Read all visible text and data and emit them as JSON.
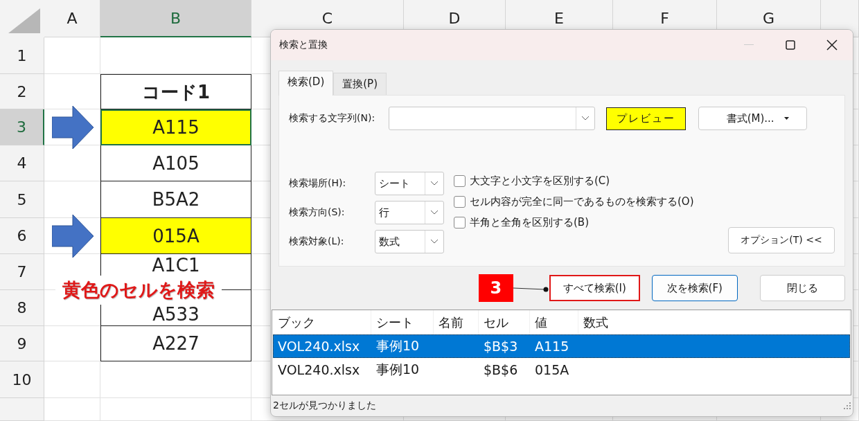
{
  "sheet": {
    "columns": [
      {
        "label": "A",
        "selected": false
      },
      {
        "label": "B",
        "selected": true
      },
      {
        "label": "C",
        "selected": false
      },
      {
        "label": "D",
        "selected": false
      },
      {
        "label": "E",
        "selected": false
      },
      {
        "label": "F",
        "selected": false
      },
      {
        "label": "G",
        "selected": false
      }
    ],
    "rows": [
      {
        "number": "1",
        "selected": false
      },
      {
        "number": "2",
        "selected": false,
        "value": "コード1",
        "kind": "header"
      },
      {
        "number": "3",
        "selected": true,
        "value": "A115",
        "kind": "data",
        "highlighted": true,
        "arrow": true
      },
      {
        "number": "4",
        "selected": false,
        "value": "A105",
        "kind": "data",
        "highlighted": false,
        "arrow": false
      },
      {
        "number": "5",
        "selected": false,
        "value": "B5A2",
        "kind": "data",
        "highlighted": false,
        "arrow": false
      },
      {
        "number": "6",
        "selected": false,
        "value": "015A",
        "kind": "data",
        "highlighted": true,
        "arrow": true
      },
      {
        "number": "7",
        "selected": false,
        "value": "A1C1",
        "kind": "data",
        "highlighted": false,
        "arrow": false
      },
      {
        "number": "8",
        "selected": false,
        "value": "A533",
        "kind": "data",
        "highlighted": false,
        "arrow": false
      },
      {
        "number": "9",
        "selected": false,
        "value": "A227",
        "kind": "data",
        "highlighted": false,
        "arrow": false
      },
      {
        "number": "10",
        "selected": false
      }
    ],
    "callout": "黄色のセルを検索"
  },
  "dialog": {
    "title": "検索と置換",
    "tabs": [
      {
        "label": "検索(D)",
        "selected": true
      },
      {
        "label": "置換(P)",
        "selected": false
      }
    ],
    "find_what": {
      "label": "検索する文字列(N):"
    },
    "preview": "プレビュー",
    "format_button": "書式(M)...",
    "dropdowns": [
      {
        "label": "検索場所(H):",
        "value": "シート"
      },
      {
        "label": "検索方向(S):",
        "value": "行"
      },
      {
        "label": "検索対象(L):",
        "value": "数式"
      }
    ],
    "checkboxes": [
      {
        "label": "大文字と小文字を区別する(C)",
        "checked": false
      },
      {
        "label": "セル内容が完全に同一であるものを検索する(O)",
        "checked": false
      },
      {
        "label": "半角と全角を区別する(B)",
        "checked": false
      }
    ],
    "options_button": "オプション(T) <<",
    "step_badge": "3",
    "buttons": [
      {
        "label": "すべて検索(I)",
        "kind": "find_all",
        "highlighted": true,
        "focused": false
      },
      {
        "label": "次を検索(F)",
        "kind": "find_next",
        "highlighted": false,
        "focused": true
      },
      {
        "label": "閉じる",
        "kind": "close",
        "highlighted": false,
        "focused": false
      }
    ],
    "results": {
      "columns": [
        "ブック",
        "シート",
        "名前",
        "セル",
        "値",
        "数式"
      ],
      "rows": [
        {
          "cells": [
            "VOL240.xlsx",
            "事例10",
            "",
            "$B$3",
            "A115",
            ""
          ],
          "selected": true
        },
        {
          "cells": [
            "VOL240.xlsx",
            "事例10",
            "",
            "$B$6",
            "015A",
            ""
          ],
          "selected": false
        }
      ]
    },
    "status": "2セルが見つかりました"
  }
}
